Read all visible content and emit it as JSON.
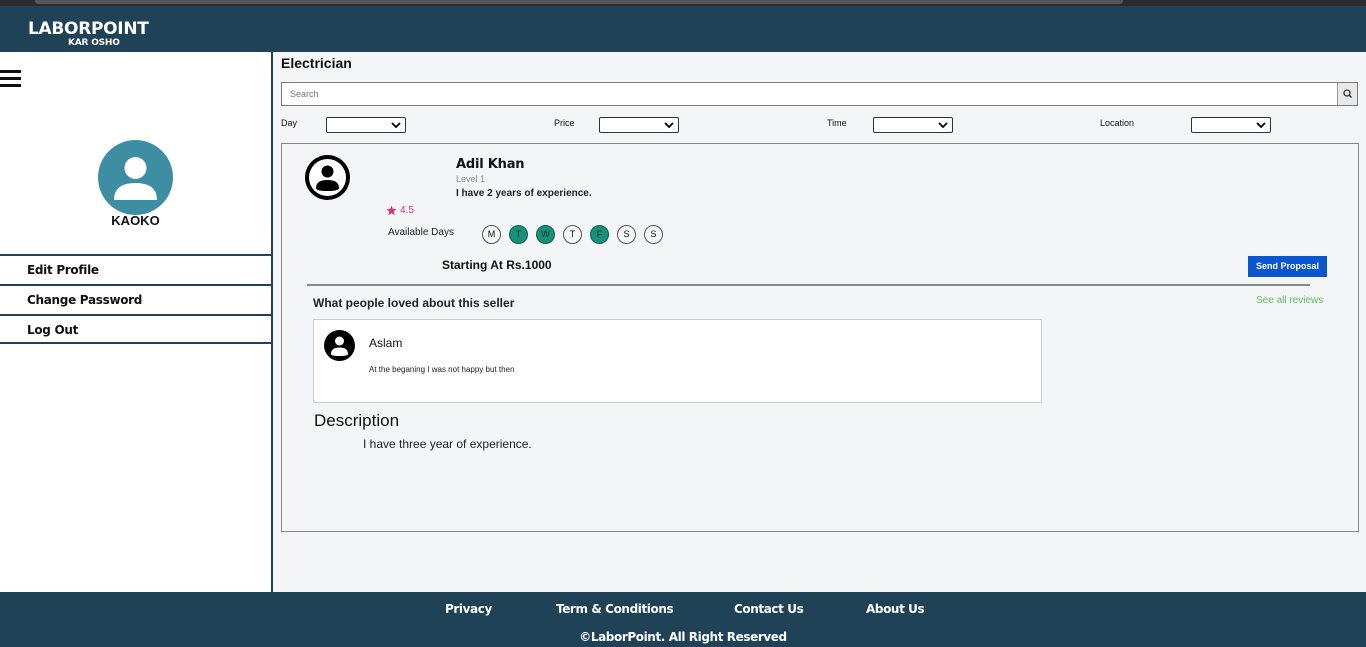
{
  "header": {
    "brand": "LABORPOINT",
    "tagline": "KAR OSHO",
    "color": "#1f4257"
  },
  "sidebar": {
    "menu_icon": "hamburger-icon",
    "avatar_icon": "user-icon",
    "avatar_color": "#3d8ea3",
    "username": "KAOKO",
    "items": [
      {
        "label": "Edit Profile"
      },
      {
        "label": "Change Password"
      },
      {
        "label": "Log Out"
      }
    ]
  },
  "main": {
    "title": "Electrician",
    "search": {
      "placeholder": "Search",
      "icon": "search-icon"
    },
    "filters": [
      {
        "label": "Day",
        "value": ""
      },
      {
        "label": "Price",
        "value": ""
      },
      {
        "label": "Time",
        "value": ""
      },
      {
        "label": "Location",
        "value": ""
      }
    ]
  },
  "seller": {
    "name": "Adil Khan",
    "level": "Level 1",
    "experience": "I have 2 years of experience.",
    "rating": "4.5",
    "rating_color": "#e0307a",
    "available_label": "Available Days",
    "days": [
      {
        "letter": "M",
        "available": false
      },
      {
        "letter": "T",
        "available": true
      },
      {
        "letter": "W",
        "available": true
      },
      {
        "letter": "T",
        "available": false
      },
      {
        "letter": "F",
        "available": true
      },
      {
        "letter": "S",
        "available": false
      },
      {
        "letter": "S",
        "available": false
      }
    ],
    "price": "Starting At Rs.1000",
    "send_label": "Send Proposal",
    "loved_title": "What people loved about this seller",
    "see_all": "See all reviews",
    "review": {
      "name": "Aslam",
      "text": "At the beganing I was not happy but then"
    },
    "description_title": "Description",
    "description": "I have three year of experience."
  },
  "footer": {
    "links": [
      {
        "label": "Privacy"
      },
      {
        "label": "Term & Conditions"
      },
      {
        "label": "Contact Us"
      },
      {
        "label": "About Us"
      }
    ],
    "copyright": "©LaborPoint. All Right Reserved"
  }
}
